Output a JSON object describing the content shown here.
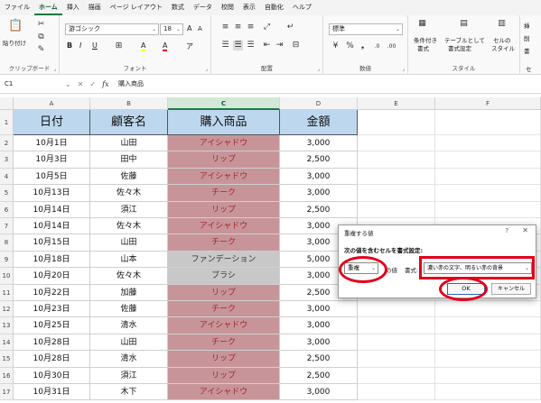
{
  "menu": [
    "ファイル",
    "ホーム",
    "挿入",
    "描画",
    "ページ レイアウト",
    "数式",
    "データ",
    "校閲",
    "表示",
    "自動化",
    "ヘルプ"
  ],
  "menu_active_index": 1,
  "ribbon": {
    "clipboard": {
      "paste": "貼り付け",
      "label": "クリップボード"
    },
    "font": {
      "name": "游ゴシック",
      "size": "18",
      "bold": "B",
      "italic": "I",
      "underline": "U",
      "grow": "A",
      "shrink": "A",
      "fill": "A",
      "color": "A",
      "phonetic": "ア",
      "label": "フォント"
    },
    "align": {
      "label": "配置"
    },
    "number": {
      "format": "標準",
      "label": "数値"
    },
    "styles": {
      "cond": "条件付き",
      "cond2": "書式",
      "table": "テーブルとして",
      "table2": "書式設定",
      "cell": "セルの",
      "cell2": "スタイル",
      "label": "スタイル"
    },
    "right_cut": "挿",
    "right_cut2": "削",
    "right_cut3": "書",
    "right_label": "セ"
  },
  "formula_bar": {
    "name_box": "C1",
    "x": "✕",
    "check": "✓",
    "fx": "fx",
    "content": "購入商品"
  },
  "columns": [
    {
      "letter": "A",
      "selected": false
    },
    {
      "letter": "B",
      "selected": false
    },
    {
      "letter": "C",
      "selected": true
    },
    {
      "letter": "D",
      "selected": false
    },
    {
      "letter": "E",
      "selected": false
    },
    {
      "letter": "F",
      "selected": false
    }
  ],
  "table": {
    "headers": [
      "日付",
      "顧客名",
      "購入商品",
      "金額"
    ],
    "rows": [
      {
        "n": "2",
        "date": "10月1日",
        "customer": "山田",
        "product": "アイシャドウ",
        "amount": "3,000",
        "style": "pink"
      },
      {
        "n": "3",
        "date": "10月3日",
        "customer": "田中",
        "product": "リップ",
        "amount": "2,500",
        "style": "pink"
      },
      {
        "n": "4",
        "date": "10月5日",
        "customer": "佐藤",
        "product": "アイシャドウ",
        "amount": "3,000",
        "style": "pink"
      },
      {
        "n": "5",
        "date": "10月13日",
        "customer": "佐々木",
        "product": "チーク",
        "amount": "3,000",
        "style": "pink"
      },
      {
        "n": "6",
        "date": "10月14日",
        "customer": "須江",
        "product": "リップ",
        "amount": "2,500",
        "style": "pink"
      },
      {
        "n": "7",
        "date": "10月14日",
        "customer": "佐々木",
        "product": "アイシャドウ",
        "amount": "3,000",
        "style": "pink"
      },
      {
        "n": "8",
        "date": "10月15日",
        "customer": "山田",
        "product": "チーク",
        "amount": "3,000",
        "style": "pink"
      },
      {
        "n": "9",
        "date": "10月18日",
        "customer": "山本",
        "product": "ファンデーション",
        "amount": "5,000",
        "style": "gray"
      },
      {
        "n": "10",
        "date": "10月20日",
        "customer": "佐々木",
        "product": "ブラシ",
        "amount": "3,000",
        "style": "gray"
      },
      {
        "n": "11",
        "date": "10月22日",
        "customer": "加藤",
        "product": "リップ",
        "amount": "2,500",
        "style": "pink"
      },
      {
        "n": "12",
        "date": "10月23日",
        "customer": "佐藤",
        "product": "チーク",
        "amount": "3,000",
        "style": "pink"
      },
      {
        "n": "13",
        "date": "10月25日",
        "customer": "清水",
        "product": "アイシャドウ",
        "amount": "3,000",
        "style": "pink"
      },
      {
        "n": "14",
        "date": "10月28日",
        "customer": "山田",
        "product": "チーク",
        "amount": "3,000",
        "style": "pink"
      },
      {
        "n": "15",
        "date": "10月28日",
        "customer": "清水",
        "product": "リップ",
        "amount": "2,500",
        "style": "pink"
      },
      {
        "n": "16",
        "date": "10月30日",
        "customer": "須江",
        "product": "リップ",
        "amount": "2,500",
        "style": "pink"
      },
      {
        "n": "17",
        "date": "10月31日",
        "customer": "木下",
        "product": "アイシャドウ",
        "amount": "3,000",
        "style": "pink"
      }
    ]
  },
  "dialog": {
    "title": "重複する値",
    "help": "?",
    "close": "✕",
    "description": "次の値を含むセルを書式設定:",
    "dup_option": "重複",
    "value_label": "の値",
    "format_label": "書式:",
    "format_option": "濃い赤の文字、明るい赤の背景",
    "ok": "OK",
    "cancel": "キャンセル"
  },
  "colors": {
    "header_fill": "#bdd7ee",
    "dup_fill": "#c79599",
    "dup_text": "#a4262c",
    "unique_fill": "#c8c8c8",
    "highlight": "#e2001a",
    "accent": "#0f7b3c"
  }
}
